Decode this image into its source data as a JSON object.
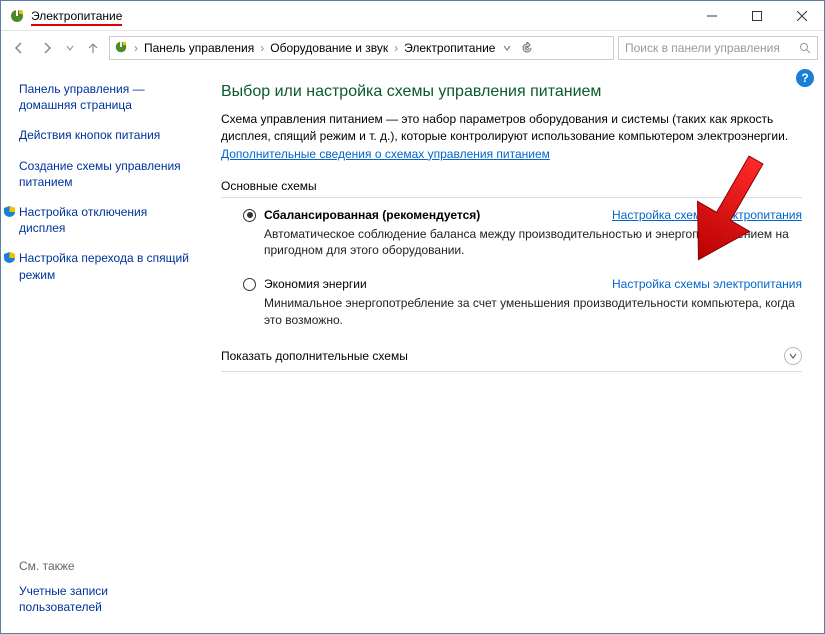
{
  "window": {
    "title": "Электропитание"
  },
  "breadcrumb": {
    "root": "Панель управления",
    "mid": "Оборудование и звук",
    "leaf": "Электропитание"
  },
  "search": {
    "placeholder": "Поиск в панели управления"
  },
  "sidebar": {
    "home": "Панель управления — домашняя страница",
    "buttons_action": "Действия кнопок питания",
    "create_scheme": "Создание схемы управления питанием",
    "display_off": "Настройка отключения дисплея",
    "sleep": "Настройка перехода в спящий режим",
    "see_also": "См. также",
    "user_accounts": "Учетные записи пользователей"
  },
  "content": {
    "heading": "Выбор или настройка схемы управления питанием",
    "description": "Схема управления питанием — это набор параметров оборудования и системы (таких как яркость дисплея, спящий режим и т. д.), которые контролируют использование компьютером электроэнергии.",
    "learn_more": "Дополнительные сведения о схемах управления питанием",
    "section_basic": "Основные схемы",
    "plan1": {
      "name": "Сбалансированная (рекомендуется)",
      "link": "Настройка схемы электропитания",
      "desc": "Автоматическое соблюдение баланса между производительностью и энергопотреблением на пригодном для этого оборудовании."
    },
    "plan2": {
      "name": "Экономия энергии",
      "link": "Настройка схемы электропитания",
      "desc": "Минимальное энергопотребление за счет уменьшения производительности компьютера, когда это возможно."
    },
    "expand": "Показать дополнительные схемы"
  }
}
